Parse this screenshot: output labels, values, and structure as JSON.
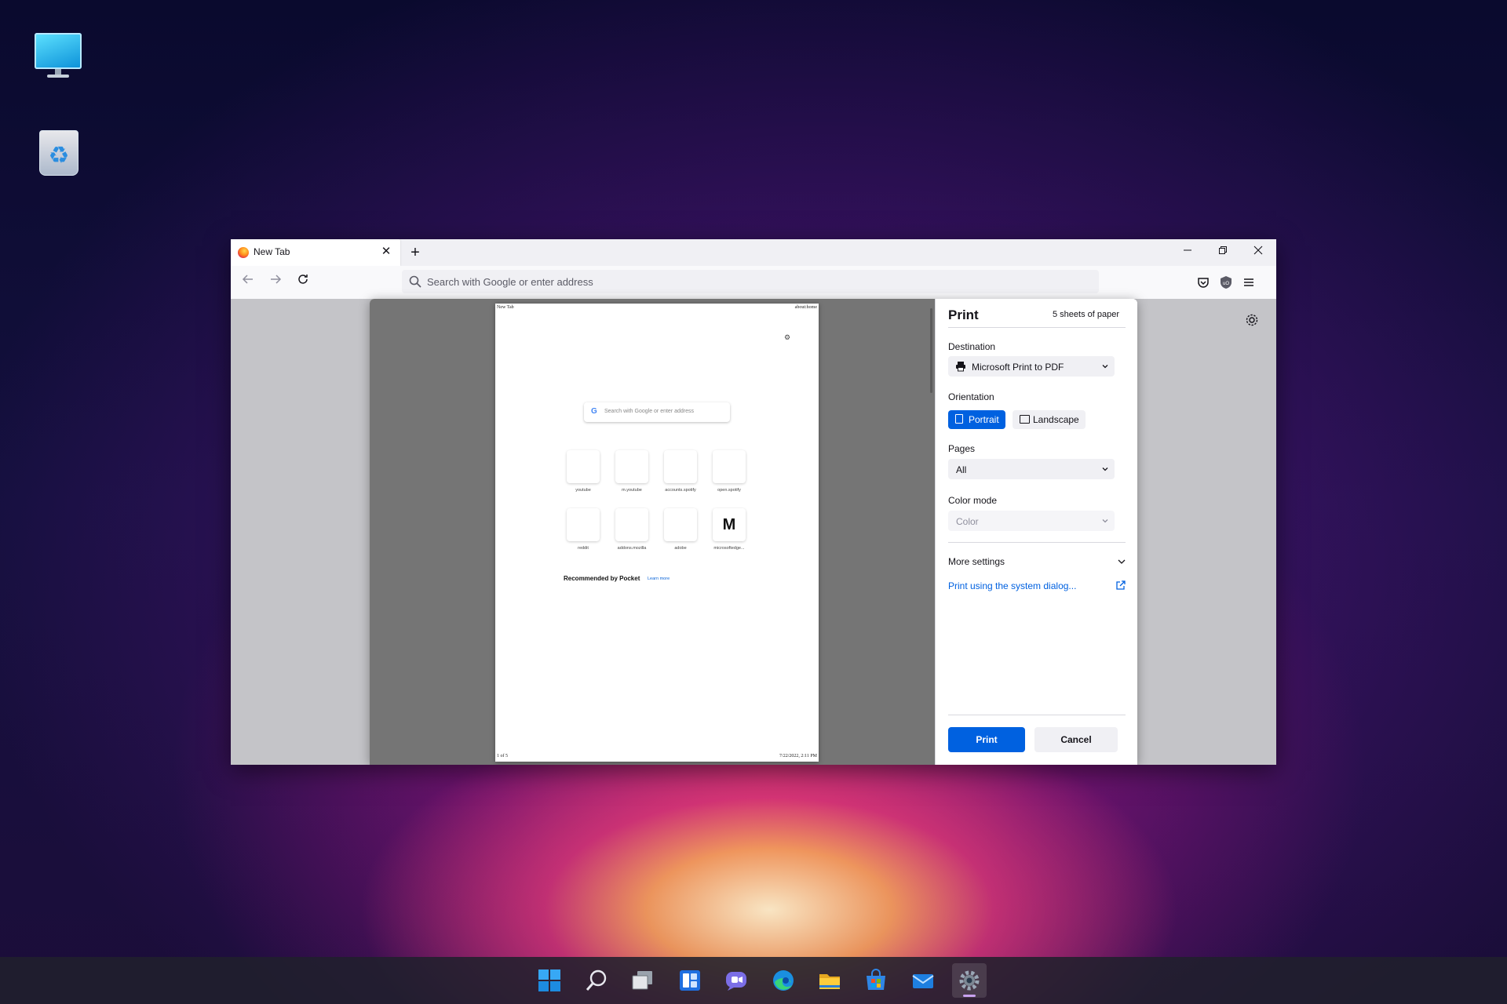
{
  "browser": {
    "tab_title": "New Tab",
    "new_tab_symbol": "+",
    "close_tab_symbol": "✕",
    "url_placeholder": "Search with Google or enter address"
  },
  "preview": {
    "header_left": "New Tab",
    "header_right": "about:home",
    "footer_left": "1 of 5",
    "footer_right": "7/22/2022, 2:11 PM",
    "search_placeholder": "Search with Google or enter address",
    "tiles": [
      {
        "label": "youtube",
        "glyph": ""
      },
      {
        "label": "m.youtube",
        "glyph": ""
      },
      {
        "label": "accounts.spotify",
        "glyph": ""
      },
      {
        "label": "open.spotify",
        "glyph": ""
      },
      {
        "label": "reddit",
        "glyph": ""
      },
      {
        "label": "addons.mozilla",
        "glyph": ""
      },
      {
        "label": "adobe",
        "glyph": ""
      },
      {
        "label": "microsoftedge...",
        "glyph": "M"
      }
    ],
    "pocket_label": "Recommended by Pocket",
    "learn_more": "Learn more"
  },
  "print_panel": {
    "title": "Print",
    "sheets": "5 sheets of paper",
    "destination_label": "Destination",
    "destination_value": "Microsoft Print to PDF",
    "orientation_label": "Orientation",
    "portrait_label": "Portrait",
    "landscape_label": "Landscape",
    "orientation_selected": "Portrait",
    "pages_label": "Pages",
    "pages_value": "All",
    "color_mode_label": "Color mode",
    "color_mode_value": "Color",
    "more_settings": "More settings",
    "system_dialog_link": "Print using the system dialog...",
    "print_button": "Print",
    "cancel_button": "Cancel"
  },
  "colors": {
    "accent": "#0061e0",
    "preview_bg": "#757575",
    "browser_chrome": "#f0f0f4"
  },
  "taskbar": {
    "apps": [
      "start-icon",
      "search-icon",
      "task-view-icon",
      "widgets-icon",
      "teams-chat-icon",
      "edge-icon",
      "file-explorer-icon",
      "store-icon",
      "mail-icon",
      "settings-icon"
    ],
    "active_app": "settings-icon"
  },
  "desktop": {
    "icons": [
      "this-pc-icon",
      "recycle-bin-icon"
    ]
  }
}
